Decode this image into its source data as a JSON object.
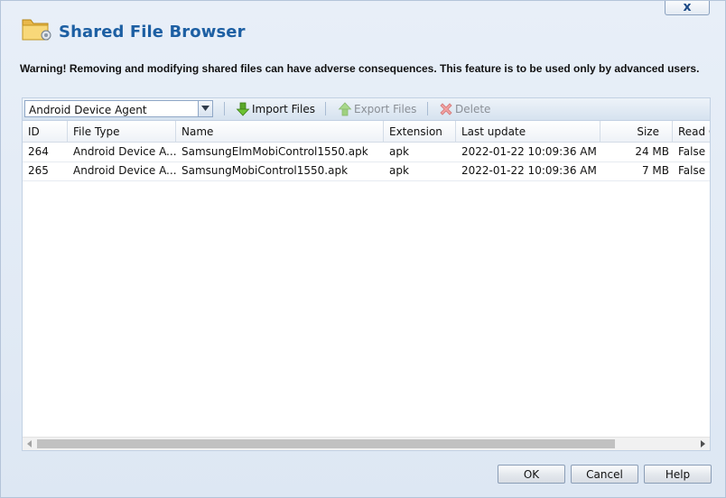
{
  "dialog": {
    "title": "Shared File Browser",
    "close_label": "x",
    "warning": "Warning! Removing and modifying shared files can have adverse consequences. This feature is to be used only by advanced users."
  },
  "toolbar": {
    "filter_value": "Android Device Agent",
    "import_label": "Import Files",
    "export_label": "Export Files",
    "delete_label": "Delete"
  },
  "grid": {
    "columns": [
      "ID",
      "File Type",
      "Name",
      "Extension",
      "Last update",
      "Size",
      "Read O"
    ],
    "rows": [
      [
        "264",
        "Android Device A...",
        "SamsungElmMobiControl1550.apk",
        "apk",
        "2022-01-22 10:09:36 AM",
        "24 MB",
        "False"
      ],
      [
        "265",
        "Android Device A...",
        "SamsungMobiControl1550.apk",
        "apk",
        "2022-01-22 10:09:36 AM",
        "7 MB",
        "False"
      ]
    ]
  },
  "footer": {
    "ok_label": "OK",
    "cancel_label": "Cancel",
    "help_label": "Help"
  },
  "icons": {
    "title": "folder-settings-icon",
    "import": "green-down-arrow-icon",
    "export": "green-up-arrow-icon",
    "delete": "red-x-icon"
  }
}
